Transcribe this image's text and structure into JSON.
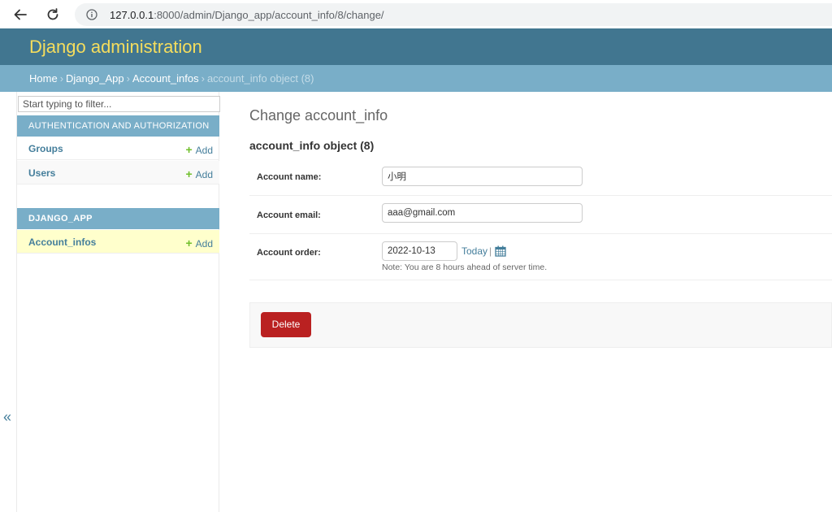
{
  "browser": {
    "url_host": "127.0.0.1",
    "url_path": ":8000/admin/Django_app/account_info/8/change/"
  },
  "header": {
    "site_title": "Django administration"
  },
  "breadcrumbs": {
    "home": "Home",
    "app": "Django_App",
    "model": "Account_infos",
    "current": "account_info object (8)"
  },
  "sidebar": {
    "filter_placeholder": "Start typing to filter...",
    "modules": [
      {
        "caption": "AUTHENTICATION AND AUTHORIZATION",
        "models": [
          {
            "name": "Groups",
            "add_label": "Add"
          },
          {
            "name": "Users",
            "add_label": "Add"
          }
        ]
      },
      {
        "caption": "DJANGO_APP",
        "models": [
          {
            "name": "Account_infos",
            "add_label": "Add"
          }
        ]
      }
    ],
    "toggle_glyph": "«"
  },
  "content": {
    "title": "Change account_info",
    "object_title": "account_info object (8)",
    "fields": {
      "account_name": {
        "label": "Account name:",
        "value": "小明"
      },
      "account_email": {
        "label": "Account email:",
        "value": "aaa@gmail.com"
      },
      "account_order": {
        "label": "Account order:",
        "value": "2022-10-13",
        "today_label": "Today",
        "separator": "|",
        "help": "Note: You are 8 hours ahead of server time."
      }
    },
    "delete_label": "Delete"
  },
  "colors": {
    "header_bg": "#417690",
    "breadcrumb_bg": "#79aec8",
    "title_yellow": "#f5dd5d",
    "link_blue": "#447e9b",
    "delete_red": "#ba2121",
    "current_row": "#ffffcc",
    "add_green": "#70bf2b"
  },
  "icons": [
    "back-arrow-icon",
    "reload-icon",
    "info-icon",
    "plus-icon",
    "calendar-icon"
  ]
}
